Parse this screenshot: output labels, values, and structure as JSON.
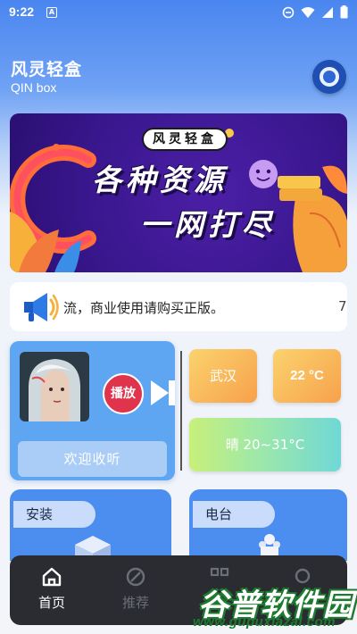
{
  "status_bar": {
    "time": "9:22",
    "notif_icon_letter": "A",
    "icons": [
      "do-not-disturb-icon",
      "wifi-icon",
      "signal-icon",
      "battery-icon"
    ]
  },
  "header": {
    "title": "风灵轻盒",
    "subtitle": "QIN box"
  },
  "banner": {
    "tag": "风灵轻盒",
    "line1": "各种资源",
    "line2": "一网打尽"
  },
  "notice": {
    "text": "流，商业使用请购买正版。",
    "more": "7"
  },
  "music": {
    "play_label": "播放",
    "welcome_label": "欢迎收听"
  },
  "weather": {
    "city": "武汉",
    "temperature": "22 °C",
    "range": "晴 20~31°C"
  },
  "cards": {
    "install_label": "安装",
    "radio_label": "电台"
  },
  "nav": {
    "items": [
      {
        "label": "首页",
        "active": true
      },
      {
        "label": "推荐",
        "active": false
      },
      {
        "label": "",
        "active": false
      },
      {
        "label": "",
        "active": false
      }
    ]
  },
  "watermark": {
    "logo": "谷普软件园",
    "url": "www.gupuxlazal.com"
  },
  "colors": {
    "primary": "#4c8ef0",
    "banner_bg": "#3a178f",
    "play": "#e0344d",
    "nav_bg": "#2a2c31"
  }
}
